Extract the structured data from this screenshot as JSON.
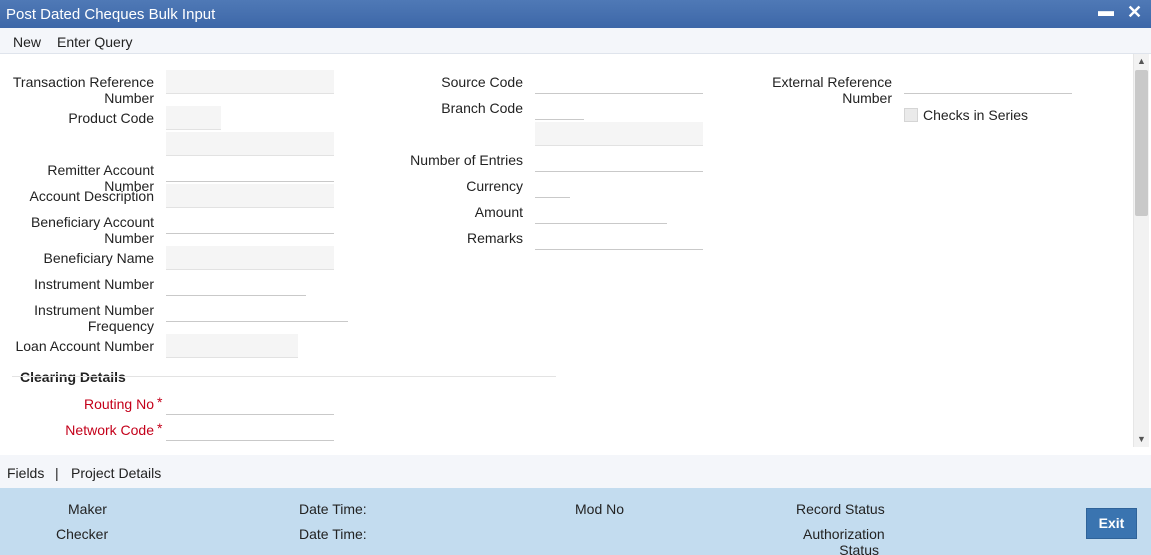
{
  "window": {
    "title": "Post Dated Cheques Bulk Input",
    "minimize_icon": "minimize-icon",
    "close_icon": "close-icon"
  },
  "menu": {
    "new": "New",
    "enter_query": "Enter Query"
  },
  "form": {
    "transaction_reference_number": {
      "label_line1": "Transaction Reference",
      "label_line2": "Number",
      "value": ""
    },
    "product_code": {
      "label": "Product Code",
      "value": ""
    },
    "product_description": {
      "value": ""
    },
    "remitter_account_number": {
      "label": "Remitter Account Number",
      "value": ""
    },
    "account_description": {
      "label": "Account Description",
      "value": ""
    },
    "beneficiary_account_number": {
      "label_line1": "Beneficiary Account",
      "label_line2": "Number",
      "value": ""
    },
    "beneficiary_name": {
      "label": "Beneficiary Name",
      "value": ""
    },
    "instrument_number": {
      "label": "Instrument Number",
      "value": ""
    },
    "instrument_number_frequency": {
      "label_line1": "Instrument Number",
      "label_line2": "Frequency",
      "value": ""
    },
    "loan_account_number": {
      "label": "Loan Account Number",
      "value": ""
    },
    "source_code": {
      "label": "Source Code",
      "value": ""
    },
    "branch_code": {
      "label": "Branch Code",
      "value": ""
    },
    "branch_description": {
      "value": ""
    },
    "number_of_entries": {
      "label": "Number of Entries",
      "value": ""
    },
    "currency": {
      "label": "Currency",
      "value": ""
    },
    "amount": {
      "label": "Amount",
      "value": ""
    },
    "remarks": {
      "label": "Remarks",
      "value": ""
    },
    "external_reference_number": {
      "label_line1": "External Reference",
      "label_line2": "Number",
      "value": ""
    },
    "checks_in_series": {
      "label": "Checks in Series",
      "checked": false
    }
  },
  "clearing": {
    "heading": "Clearing Details",
    "routing_no": {
      "label": "Routing No",
      "value": ""
    },
    "network_code": {
      "label": "Network Code",
      "value": ""
    },
    "required_marker": "*"
  },
  "footer_links": {
    "fields": "Fields",
    "separator": "|",
    "project_details": "Project Details"
  },
  "audit": {
    "maker": "Maker",
    "checker": "Checker",
    "date_time_1": "Date Time:",
    "date_time_2": "Date Time:",
    "mod_no": "Mod No",
    "record_status": "Record Status",
    "authorization_status_line1": "Authorization",
    "authorization_status_line2": "Status",
    "exit": "Exit"
  },
  "colors": {
    "title_bar": "#4470b0",
    "required_label": "#c4001a",
    "audit_panel": "#c3dcef",
    "exit_button": "#3a74b0"
  }
}
